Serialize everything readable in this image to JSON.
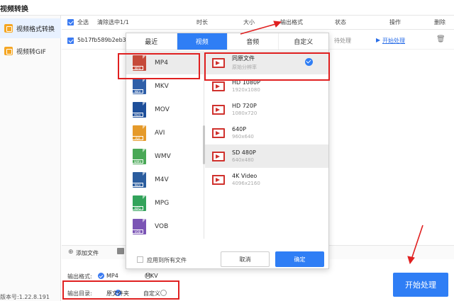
{
  "window": {
    "title": "视频转换"
  },
  "sidebar": {
    "items": [
      {
        "label": "视频格式转换"
      },
      {
        "label": "视频转GIF"
      }
    ],
    "version": "版本号:1.22.8.191"
  },
  "table": {
    "select_all": "全选",
    "remove_selected": "清除选中1/1",
    "headers": {
      "duration": "时长",
      "size": "大小",
      "output_format": "输出格式",
      "status": "状态",
      "action": "操作",
      "delete": "删除"
    },
    "rows": [
      {
        "name": "5b17fb589b2eb3",
        "status": "待处理",
        "action": "开始处理"
      }
    ]
  },
  "bottom": {
    "add_file": "添加文件",
    "output_format_label": "输出格式:",
    "output_format_opts": [
      "MP4",
      "MKV"
    ],
    "output_dir_label": "输出目录:",
    "output_dir_opts": [
      "原文件夹",
      "自定义"
    ],
    "start_button": "开始处理"
  },
  "popup": {
    "tabs": [
      "最近",
      "视频",
      "音频",
      "自定义"
    ],
    "active_tab": "视频",
    "formats": [
      {
        "label": "MP4",
        "color": "#c54a3a"
      },
      {
        "label": "MKV",
        "color": "#2f5fa8"
      },
      {
        "label": "MOV",
        "color": "#1e4f9a"
      },
      {
        "label": "AVI",
        "color": "#e59a2a"
      },
      {
        "label": "WMV",
        "color": "#49a856"
      },
      {
        "label": "M4V",
        "color": "#2b5d9e"
      },
      {
        "label": "MPG",
        "color": "#33a35b"
      },
      {
        "label": "VOB",
        "color": "#7b55b5"
      }
    ],
    "options": [
      {
        "name": "同原文件",
        "sub": "原始分辨率"
      },
      {
        "name": "HD 1080P",
        "sub": "1920x1080"
      },
      {
        "name": "HD 720P",
        "sub": "1080x720"
      },
      {
        "name": "640P",
        "sub": "960x640"
      },
      {
        "name": "SD 480P",
        "sub": "640x480"
      },
      {
        "name": "4K Video",
        "sub": "4096x2160"
      }
    ],
    "apply_all": "应用到所有文件",
    "cancel": "取消",
    "ok": "确定"
  }
}
